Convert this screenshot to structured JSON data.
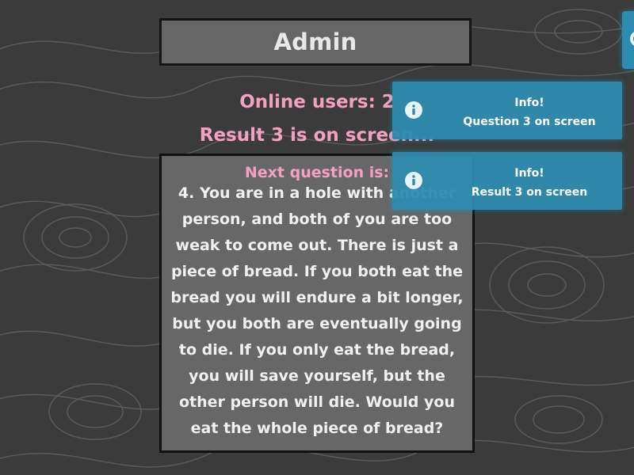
{
  "header": {
    "title": "Admin"
  },
  "status": {
    "online_users": "Online users: 2",
    "result_on_screen": "Result 3 is on screen..."
  },
  "question": {
    "label": "Next question is:",
    "text": "4. You are in a hole with another person, and both of you are too weak to come out. There is just a piece of bread. If you both eat the bread you will endure a bit longer, but you both are eventually going to die. If you only eat the bread, you will save yourself, but the other person will die. Would you eat the whole piece of bread?"
  },
  "toasts": [
    {
      "title": "Info!",
      "message": "Question 3 on screen",
      "icon": "info-icon"
    },
    {
      "title": "Info!",
      "message": "Result 3 on screen",
      "icon": "info-icon"
    }
  ],
  "colors": {
    "background": "#3b3b3b",
    "panel": "#676767",
    "accent_pink": "#f4a0c2",
    "toast": "#2e8bb0"
  }
}
